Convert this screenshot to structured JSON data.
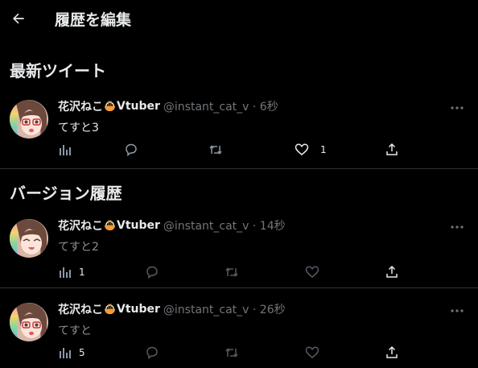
{
  "header": {
    "title": "履歴を編集",
    "back_icon": "arrow-left-icon"
  },
  "latest": {
    "section_title": "最新ツイート",
    "tweet": {
      "name": "花沢ねこ",
      "name_suffix": "Vtuber",
      "handle": "@instant_cat_v · 6秒",
      "text": "てすと3",
      "views": "",
      "like_count": "1"
    }
  },
  "history": {
    "section_title": "バージョン履歴",
    "tweets": [
      {
        "name": "花沢ねこ",
        "name_suffix": "Vtuber",
        "handle": "@instant_cat_v · 14秒",
        "text": "てすと2",
        "views": "1"
      },
      {
        "name": "花沢ねこ",
        "name_suffix": "Vtuber",
        "handle": "@instant_cat_v · 26秒",
        "text": "てすと",
        "views": "5"
      }
    ]
  },
  "colors": {
    "background": "#000000",
    "text": "#e7e9ea",
    "muted": "#71767b",
    "divider": "#2f3336"
  }
}
